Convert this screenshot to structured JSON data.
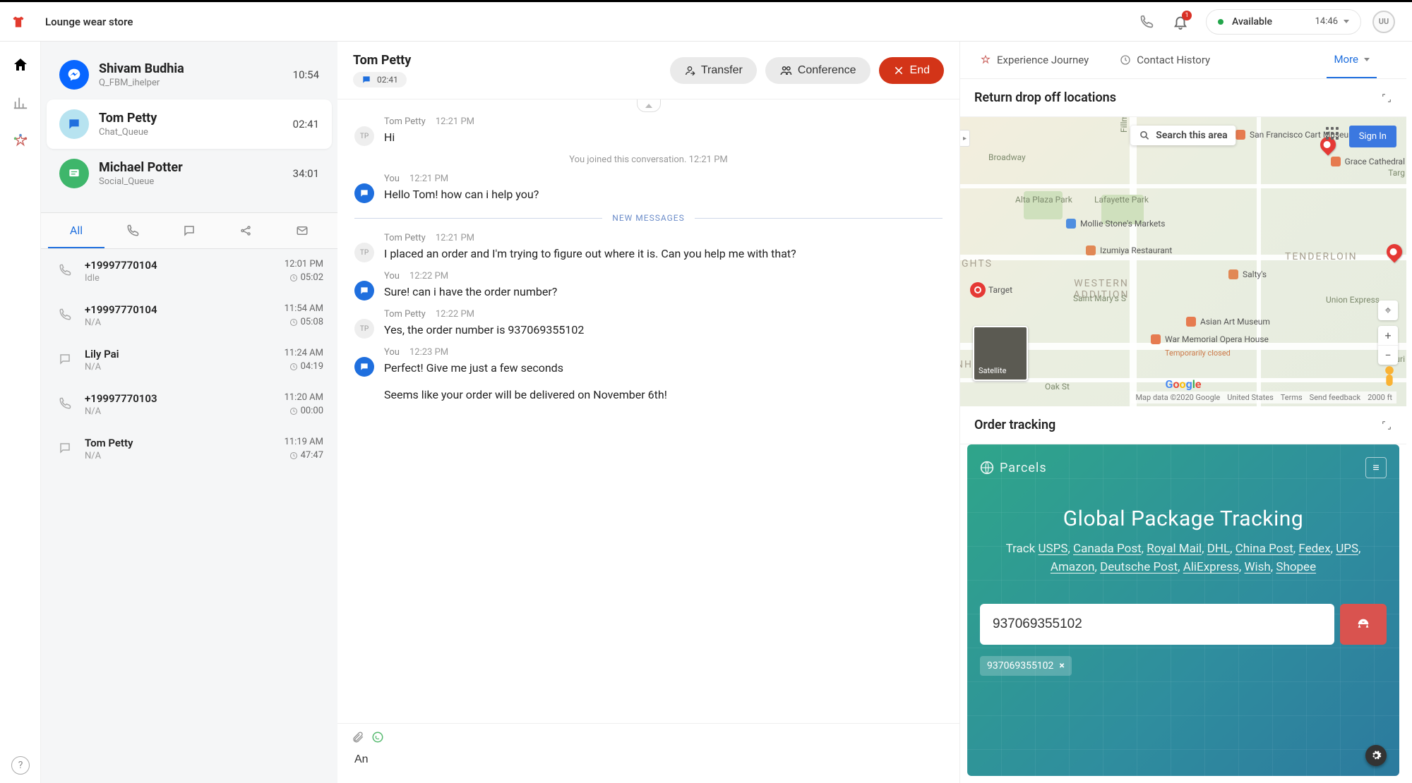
{
  "topbar": {
    "brand": "Lounge wear store",
    "notif_count": "1",
    "availability_label": "Available",
    "clock": "14:46",
    "user_initials": "UU"
  },
  "contacts": [
    {
      "name": "Shivam Budhia",
      "queue": "Q_FBM_ihelper",
      "timer": "10:54"
    },
    {
      "name": "Tom Petty",
      "queue": "Chat_Queue",
      "timer": "02:41"
    },
    {
      "name": "Michael Potter",
      "queue": "Social_Queue",
      "timer": "34:01"
    }
  ],
  "history_tabs": {
    "all": "All"
  },
  "history": [
    {
      "name": "+19997770104",
      "sub": "Idle",
      "time": "12:01 PM",
      "dur": "05:02",
      "kind": "phone"
    },
    {
      "name": "+19997770104",
      "sub": "N/A",
      "time": "11:54 AM",
      "dur": "05:08",
      "kind": "phone"
    },
    {
      "name": "Lily Pai",
      "sub": "N/A",
      "time": "11:24 AM",
      "dur": "04:19",
      "kind": "chat"
    },
    {
      "name": "+19997770103",
      "sub": "N/A",
      "time": "11:20 AM",
      "dur": "00:00",
      "kind": "phone"
    },
    {
      "name": "Tom Petty",
      "sub": "N/A",
      "time": "11:19 AM",
      "dur": "47:47",
      "kind": "chat"
    }
  ],
  "chat": {
    "header_name": "Tom Petty",
    "header_timer": "02:41",
    "buttons": {
      "transfer": "Transfer",
      "conference": "Conference",
      "end": "End"
    },
    "system_joined": "You joined this conversation. 12:21 PM",
    "new_messages_label": "NEW MESSAGES",
    "messages": [
      {
        "sender": "Tom Petty",
        "time": "12:21 PM",
        "text": "Hi",
        "avatar": "TP"
      },
      {
        "sender": "You",
        "time": "12:21 PM",
        "text": "Hello Tom! how can i help you?",
        "avatar": "You"
      },
      {
        "sender": "Tom Petty",
        "time": "12:21 PM",
        "text": "I placed an order and I'm trying to figure out where it is. Can you help me with that?",
        "avatar": "TP"
      },
      {
        "sender": "You",
        "time": "12:22 PM",
        "text": "Sure! can i have the order number?",
        "avatar": "You"
      },
      {
        "sender": "Tom Petty",
        "time": "12:22 PM",
        "text": "Yes, the order number is 937069355102",
        "avatar": "TP"
      },
      {
        "sender": "You",
        "time": "12:23 PM",
        "text": "Perfect! Give me just a few seconds",
        "text2": "Seems like your order will be delivered on November 6th!",
        "avatar": "You"
      }
    ],
    "composer_value": "An"
  },
  "right": {
    "tabs": {
      "experience": "Experience Journey",
      "history": "Contact History",
      "more": "More"
    },
    "return_title": "Return drop off locations",
    "map": {
      "search_label": "Search this area",
      "signin": "Sign In",
      "satellite": "Satellite",
      "attribution": [
        "Map data ©2020 Google",
        "United States",
        "Terms",
        "Send feedback",
        "2000 ft"
      ],
      "pois": {
        "sf_cartoon": "San Francisco Cart Museum",
        "grace": "Grace Cathedral",
        "mollie": "Mollie Stone's Markets",
        "izumiya": "Izumiya Restaurant",
        "saltys": "Salty's",
        "target": "Target",
        "asian_art": "Asian Art Museum",
        "war_mem": "War Memorial Opera House",
        "war_sub": "Temporarily closed"
      },
      "areas": {
        "tenderloin": "TENDERLOIN",
        "western": "WESTERN ADDITION",
        "nhandle": "NHANDLE",
        "ghts": "GHTS",
        "fillmore": "Fillmore St",
        "union": "Union Express",
        "broadway": "Broadway",
        "alta": "Alta Plaza Park",
        "lafayette": "Lafayette Park",
        "oak": "Oak St",
        "targ": "Targ",
        "mauri": "Mauri",
        "stmarys": "Saint Mary's S"
      }
    },
    "tracking_title": "Order tracking",
    "parcels": {
      "logo": "Parcels",
      "headline": "Global Package Tracking",
      "desc_prefix": "Track ",
      "carriers": [
        "USPS",
        "Canada Post",
        "Royal Mail",
        "DHL",
        "China Post",
        "Fedex",
        "UPS",
        "Amazon",
        "Deutsche Post",
        "AliExpress",
        "Wish",
        "Shopee"
      ],
      "input_value": "937069355102",
      "chip": "937069355102"
    }
  }
}
